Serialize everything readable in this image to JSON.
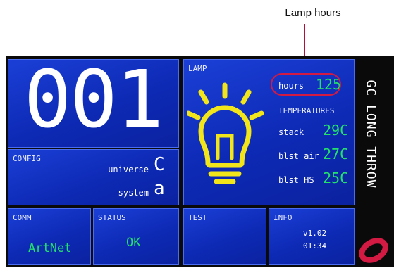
{
  "annotation": {
    "label": "Lamp hours"
  },
  "display": {
    "fixture_number": "001",
    "config": {
      "title": "CONFIG",
      "universe_label": "universe",
      "universe_value": "C",
      "system_label": "system",
      "system_value": "a"
    },
    "lamp": {
      "title": "LAMP",
      "hours_label": "hours",
      "hours_value": "125",
      "temperatures_title": "TEMPERATURES",
      "stack_label": "stack",
      "stack_value": "29C",
      "blst_air_label": "blst air",
      "blst_air_value": "27C",
      "blst_hs_label": "blst HS",
      "blst_hs_value": "25C"
    },
    "comm": {
      "title": "COMM",
      "value": "ArtNet"
    },
    "status": {
      "title": "STATUS",
      "value": "OK"
    },
    "test": {
      "title": "TEST"
    },
    "info": {
      "title": "INFO",
      "version": "v1.02",
      "time": "01:34"
    },
    "side_label": "GC LONG THROW"
  },
  "colors": {
    "panel_blue": "#1332c8",
    "value_green": "#22e36a",
    "bulb_yellow": "#f2e61a",
    "annotation_red": "#d21a43"
  },
  "icons": {
    "lamp": "lightbulb-icon",
    "brand": "brand-logo"
  }
}
